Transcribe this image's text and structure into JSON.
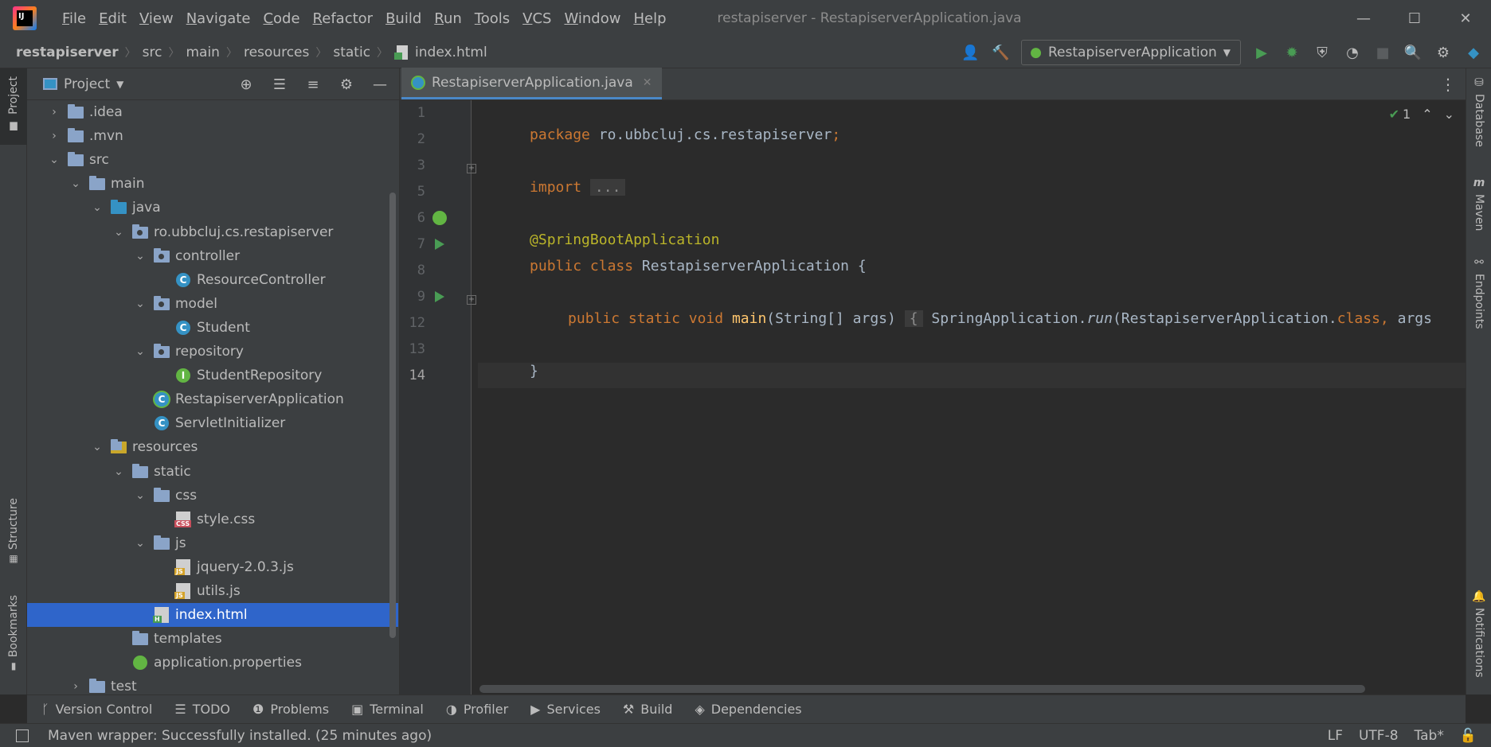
{
  "window": {
    "title": "restapiserver - RestapiserverApplication.java",
    "menu": [
      "File",
      "Edit",
      "View",
      "Navigate",
      "Code",
      "Refactor",
      "Build",
      "Run",
      "Tools",
      "VCS",
      "Window",
      "Help"
    ],
    "controls": {
      "minimize": "—",
      "maximize": "☐",
      "close": "✕"
    }
  },
  "breadcrumb": [
    "restapiserver",
    "src",
    "main",
    "resources",
    "static",
    "index.html"
  ],
  "toolbar": {
    "run_config": "RestapiserverApplication"
  },
  "left_strip": {
    "project": "Project",
    "structure": "Structure",
    "bookmarks": "Bookmarks"
  },
  "right_strip": {
    "database": "Database",
    "maven": "Maven",
    "endpoints": "Endpoints",
    "notifications": "Notifications"
  },
  "project_panel": {
    "title": "Project",
    "tree": [
      {
        "label": ".idea",
        "indent": 0,
        "expanded": false,
        "icon": "folder"
      },
      {
        "label": ".mvn",
        "indent": 0,
        "expanded": false,
        "icon": "folder"
      },
      {
        "label": "src",
        "indent": 0,
        "expanded": true,
        "icon": "folder"
      },
      {
        "label": "main",
        "indent": 1,
        "expanded": true,
        "icon": "folder"
      },
      {
        "label": "java",
        "indent": 2,
        "expanded": true,
        "icon": "folder-blue"
      },
      {
        "label": "ro.ubbcluj.cs.restapiserver",
        "indent": 3,
        "expanded": true,
        "icon": "package"
      },
      {
        "label": "controller",
        "indent": 4,
        "expanded": true,
        "icon": "package"
      },
      {
        "label": "ResourceController",
        "indent": 5,
        "icon": "class"
      },
      {
        "label": "model",
        "indent": 4,
        "expanded": true,
        "icon": "package"
      },
      {
        "label": "Student",
        "indent": 5,
        "icon": "class"
      },
      {
        "label": "repository",
        "indent": 4,
        "expanded": true,
        "icon": "package"
      },
      {
        "label": "StudentRepository",
        "indent": 5,
        "icon": "interface"
      },
      {
        "label": "RestapiserverApplication",
        "indent": 4,
        "icon": "spring-class"
      },
      {
        "label": "ServletInitializer",
        "indent": 4,
        "icon": "class"
      },
      {
        "label": "resources",
        "indent": 2,
        "expanded": true,
        "icon": "folder-res"
      },
      {
        "label": "static",
        "indent": 3,
        "expanded": true,
        "icon": "folder"
      },
      {
        "label": "css",
        "indent": 4,
        "expanded": true,
        "icon": "folder"
      },
      {
        "label": "style.css",
        "indent": 5,
        "icon": "css"
      },
      {
        "label": "js",
        "indent": 4,
        "expanded": true,
        "icon": "folder"
      },
      {
        "label": "jquery-2.0.3.js",
        "indent": 5,
        "icon": "js"
      },
      {
        "label": "utils.js",
        "indent": 5,
        "icon": "js"
      },
      {
        "label": "index.html",
        "indent": 4,
        "icon": "html",
        "selected": true
      },
      {
        "label": "templates",
        "indent": 3,
        "icon": "folder"
      },
      {
        "label": "application.properties",
        "indent": 3,
        "icon": "properties"
      },
      {
        "label": "test",
        "indent": 1,
        "expanded": false,
        "icon": "folder"
      }
    ]
  },
  "editor": {
    "tab": "RestapiserverApplication.java",
    "inspection_count": "1",
    "line_numbers": [
      "1",
      "2",
      "3",
      "5",
      "6",
      "7",
      "8",
      "9",
      "12",
      "13",
      "14"
    ],
    "code": {
      "l1_kw": "package",
      "l1_rest": " ro.ubbcluj.cs.restapiserver",
      "l1_semi": ";",
      "l3_kw": "import",
      "l3_folded": "...",
      "l6_ann": "@SpringBootApplication",
      "l7_kw": "public class",
      "l7_name": " RestapiserverApplication {",
      "l9_kw": "public static void",
      "l9_fn": " main",
      "l9_args": "(String[] args)",
      "l9_brace": "{",
      "l9_call1": " SpringApplication.",
      "l9_call2": "run",
      "l9_call3": "(RestapiserverApplication.",
      "l9_class": "class,",
      "l9_tail": " args",
      "l13": "}"
    }
  },
  "bottom_tabs": [
    "Version Control",
    "TODO",
    "Problems",
    "Terminal",
    "Profiler",
    "Services",
    "Build",
    "Dependencies"
  ],
  "status": {
    "message": "Maven wrapper: Successfully installed. (25 minutes ago)",
    "line_sep": "LF",
    "encoding": "UTF-8",
    "indent": "Tab*"
  }
}
